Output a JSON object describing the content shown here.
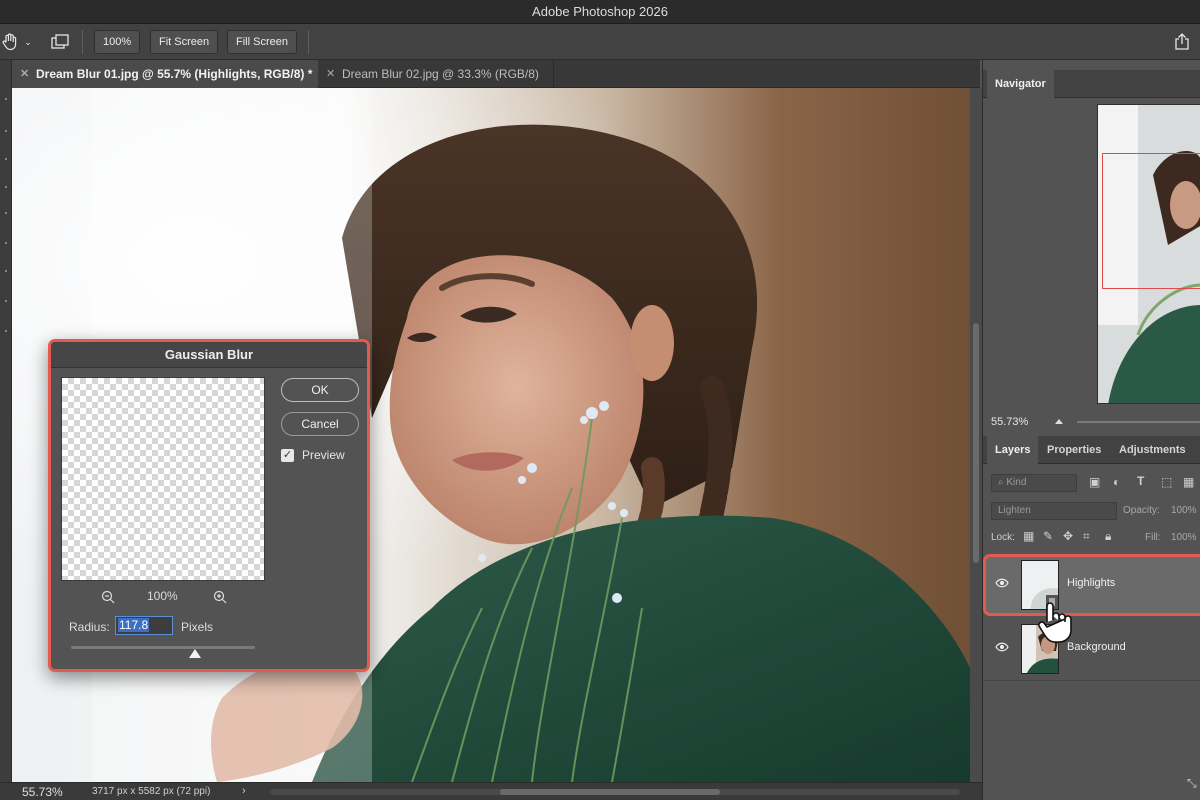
{
  "app": {
    "title": "Adobe Photoshop 2026"
  },
  "options_bar": {
    "hand_tool_icon": "hand-icon",
    "zoom_100_label": "100%",
    "fit_screen_label": "Fit Screen",
    "fill_screen_label": "Fill Screen"
  },
  "tabs": [
    {
      "label": "Dream Blur 01.jpg @ 55.7% (Highlights, RGB/8) *",
      "active": true
    },
    {
      "label": "Dream Blur 02.jpg @ 33.3% (RGB/8)",
      "active": false
    }
  ],
  "status_bar": {
    "zoom": "55.73%",
    "doc_info": "3717 px x 5582 px (72 ppi)",
    "arrow": "›"
  },
  "dialog": {
    "title": "Gaussian Blur",
    "ok_label": "OK",
    "cancel_label": "Cancel",
    "preview_label": "Preview",
    "preview_checked": true,
    "preview_zoom": "100%",
    "radius_label": "Radius:",
    "radius_value": "117.8",
    "radius_unit": "Pixels",
    "slider_level_percent": 72
  },
  "navigator": {
    "tab_label": "Navigator",
    "zoom": "55.73%"
  },
  "layers_panel": {
    "tabs": [
      "Layers",
      "Properties",
      "Adjustments"
    ],
    "filter_kind": "Kind",
    "blend_mode": "Lighten",
    "opacity_label": "Opacity:",
    "opacity_value": "100%",
    "lock_label": "Lock:",
    "fill_label": "Fill:",
    "fill_value": "100%",
    "layers": [
      {
        "name": "Highlights",
        "selected": true,
        "visible": true
      },
      {
        "name": "Background",
        "selected": false,
        "visible": true
      }
    ]
  },
  "colors": {
    "highlight_border": "#e35b4f",
    "selection_blue": "#3a6fc4",
    "sweater_green": "#1f4a3a"
  }
}
